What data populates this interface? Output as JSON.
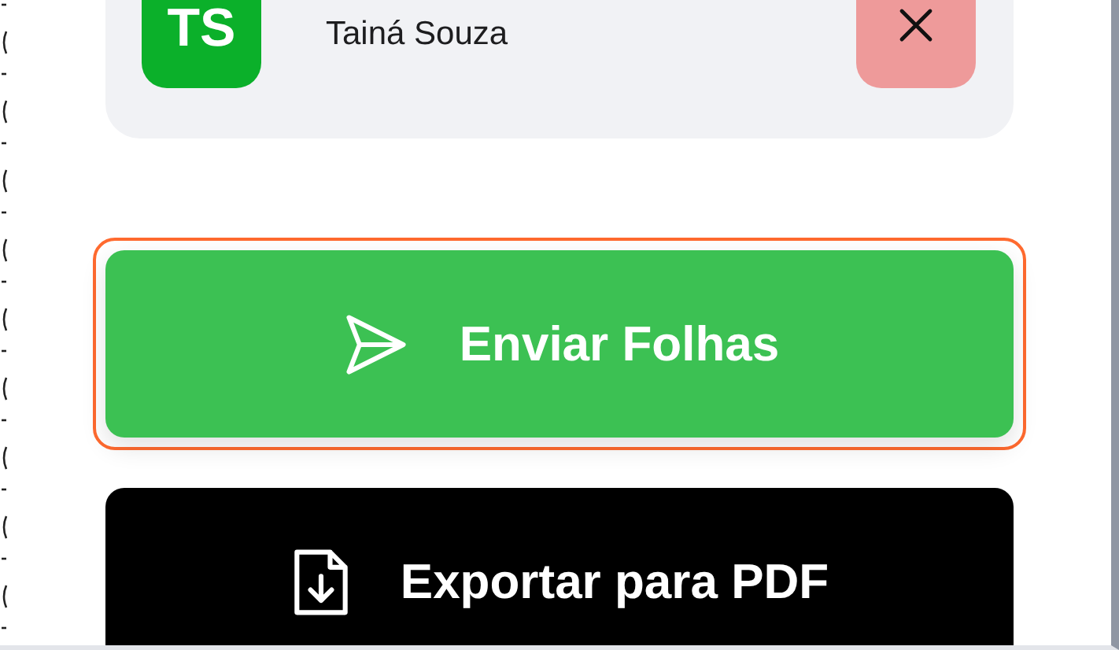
{
  "recipient": {
    "initials": "TS",
    "name": "Tainá Souza"
  },
  "actions": [
    {
      "kind": "send",
      "label": "Enviar Folhas",
      "focused": true
    },
    {
      "kind": "export",
      "label": "Exportar para PDF",
      "focused": false
    }
  ]
}
